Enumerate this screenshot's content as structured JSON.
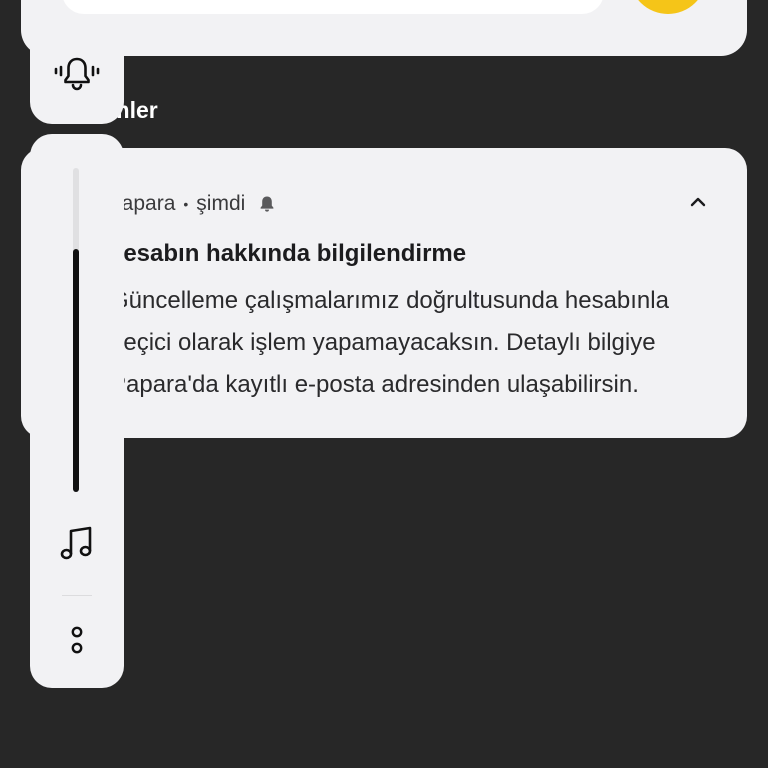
{
  "notifications_header": "Bildirimler",
  "notification": {
    "app_name": "papara",
    "time": "şimdi",
    "title": "Hesabın hakkında bilgilendirme",
    "body_lines": [
      "Güncelleme çalışmalarımız doğrultusunda hesabınla",
      "geçici olarak işlem yapamayacaksın. Detaylı bilgiye",
      "Papara'da kayıtlı e-posta adresinden ulaşabilirsin."
    ]
  },
  "volume_panel": {
    "level_fraction": 0.75,
    "ringer_icon": "bell-vibrate-icon",
    "stream_icon": "music-note-icon",
    "more_icon": "more-options-icon"
  },
  "colors": {
    "background": "#272727",
    "card": "#f2f2f4",
    "accent": "#f5c518"
  }
}
